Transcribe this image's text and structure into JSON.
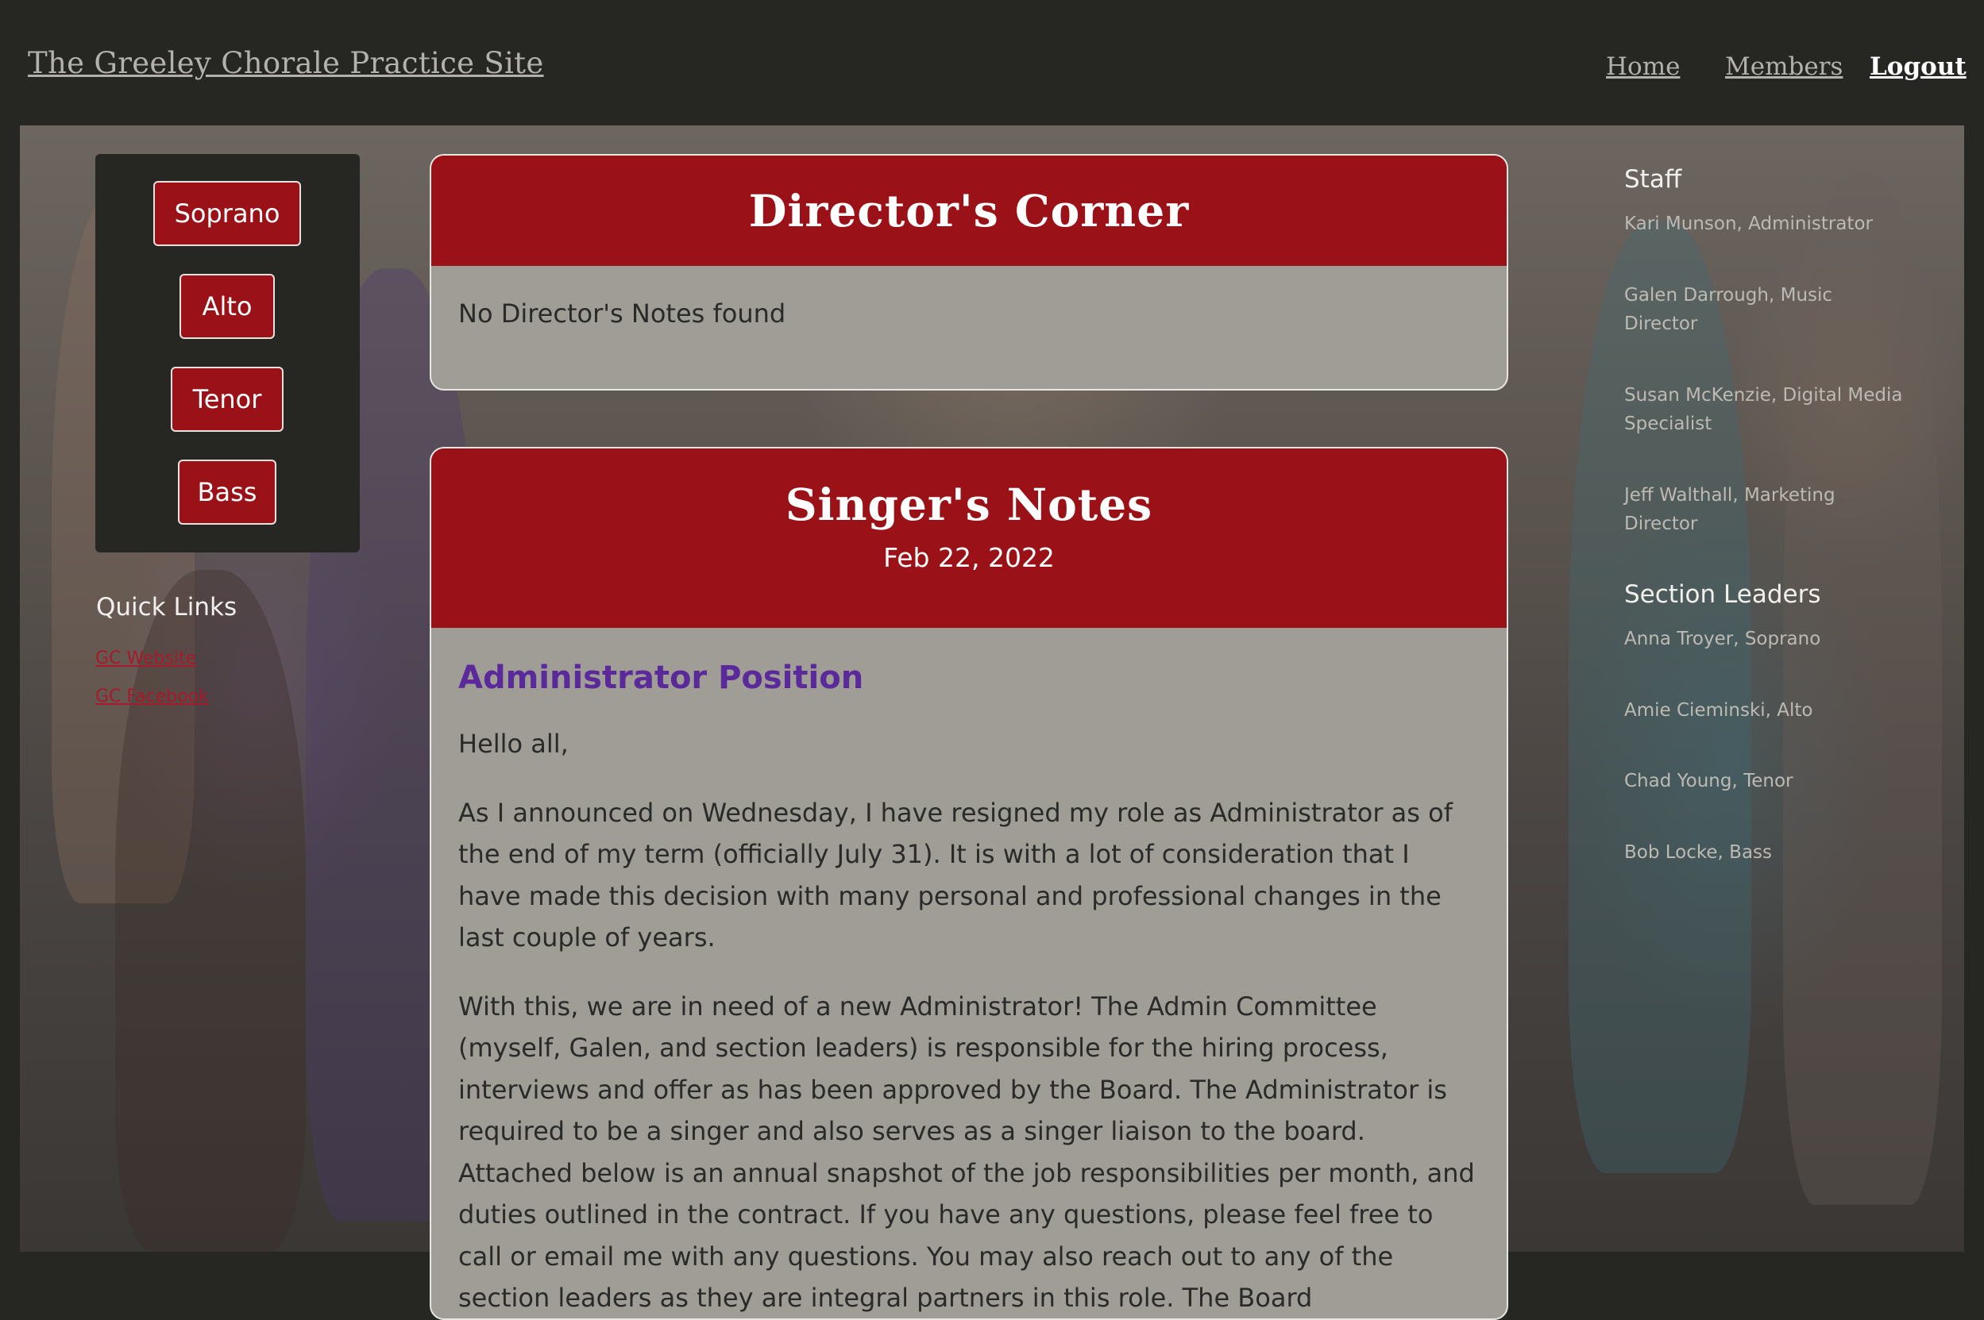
{
  "header": {
    "site_title": "The Greeley Chorale Practice Site",
    "nav": {
      "home": "Home",
      "members": "Members",
      "logout": "Logout"
    }
  },
  "voice_parts": {
    "soprano": "Soprano",
    "alto": "Alto",
    "tenor": "Tenor",
    "bass": "Bass"
  },
  "quick_links": {
    "title": "Quick Links",
    "website": "GC Website",
    "facebook": "GC Facebook"
  },
  "directors_corner": {
    "title": "Director's Corner",
    "empty_text": "No Director's Notes found"
  },
  "singers_notes": {
    "title": "Singer's Notes",
    "date": "Feb 22, 2022",
    "post_title": "Administrator Position",
    "greeting": "Hello all,",
    "paragraph1": "As I announced on Wednesday, I have resigned my role as Administrator as of the end of my term (officially July 31). It is with a lot of consideration that I have made this decision with many personal and professional changes in the last couple of years.",
    "paragraph2": "With this, we are in need of a new Administrator! The Admin Committee (myself, Galen, and section leaders) is responsible for the hiring process, interviews and offer as has been approved by the Board. The Administrator is required to be a singer and also serves as a singer liaison to the board. Attached below is an annual snapshot of the job responsibilities per month, and duties outlined in the contract. If you have any questions, please feel free to call or email me with any questions. You may also reach out to any of the section leaders as they are integral partners in this role. The Board"
  },
  "staff": {
    "heading": "Staff",
    "members": [
      "Kari Munson, Administrator",
      "Galen Darrough, Music Director",
      "Susan McKenzie, Digital Media Specialist",
      "Jeff Walthall, Marketing Director"
    ]
  },
  "section_leaders": {
    "heading": "Section Leaders",
    "members": [
      "Anna Troyer, Soprano",
      "Amie Cieminski, Alto",
      "Chad Young, Tenor",
      "Bob Locke, Bass"
    ]
  },
  "colors": {
    "header_bg": "#262623",
    "accent_red": "#9a1217",
    "card_bg": "#a09d96",
    "post_title": "#5a2a9a",
    "link_red": "#a8192a"
  }
}
